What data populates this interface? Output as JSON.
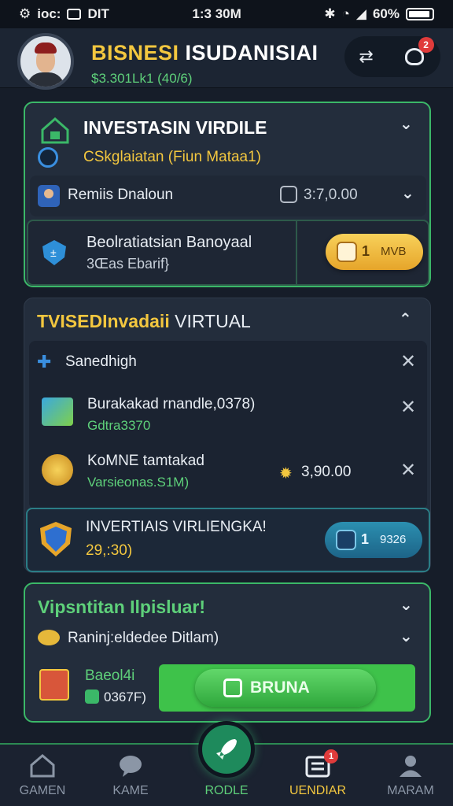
{
  "status_bar": {
    "left_text": "ioc:",
    "carrier": "DIT",
    "time": "1:3 30M",
    "battery": "60%"
  },
  "header": {
    "title_part1": "BISNESI",
    "title_part2": "ISUDANISIAI",
    "subtitle": "$3.301Lk1 (40/6)",
    "notification_count": "2"
  },
  "card1": {
    "title": "INVESTASIN VIRDILE",
    "subtitle": "CSkglaiatan (Fiun Mataa1)",
    "row1": {
      "label": "Remiis Dnaloun",
      "value": "3:7,0.00"
    },
    "row2": {
      "line1": "Beolratiatsian Banoyaal",
      "line2": "3Œas Ebarif}",
      "badge_value": "1",
      "badge_text": "MVB"
    }
  },
  "card2": {
    "title_part1": "TVISEDInvadaii",
    "title_part2": "VIRTUAL",
    "items": [
      {
        "label": "Sanedhigh",
        "sub": ""
      },
      {
        "label": "Burakakad rnandle,0378)",
        "sub": "Gdtra3370"
      },
      {
        "label": "KoMNE tamtakad",
        "sub": "Varsieonas.S1M)",
        "value": "3,90.00"
      }
    ],
    "sub_card": {
      "title": "INVERTIAIS VIRLIENGKA!",
      "value": "29,:30)",
      "badge_value": "1",
      "badge_text": "9326"
    }
  },
  "card3": {
    "title": "Vipsntitan Ilpisluar!",
    "row1_label": "Raninj:eldedee Ditlam)",
    "row2_title": "Baeol4i",
    "row2_value": "0367F)",
    "button_label": "BRUNA"
  },
  "bottom_nav": [
    {
      "label": "GAMEN"
    },
    {
      "label": "KAME"
    },
    {
      "label": "RODLE"
    },
    {
      "label": "UENDIAR",
      "badge": "1"
    },
    {
      "label": "MARAM"
    }
  ],
  "colors": {
    "accent_green": "#3bb868",
    "gold": "#f3c73f",
    "teal": "#2d8a7a",
    "bg": "#161d29"
  }
}
